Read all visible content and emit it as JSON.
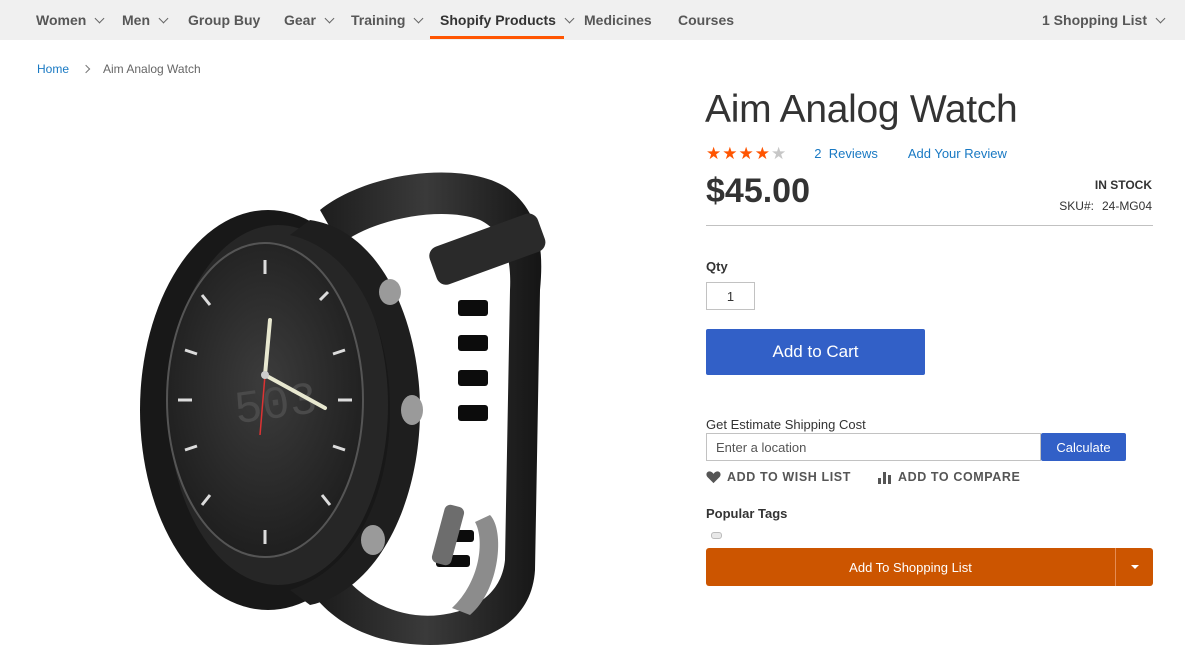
{
  "nav": {
    "items": [
      {
        "label": "Women",
        "has_menu": true
      },
      {
        "label": "Men",
        "has_menu": true
      },
      {
        "label": "Group Buy",
        "has_menu": false
      },
      {
        "label": "Gear",
        "has_menu": true
      },
      {
        "label": "Training",
        "has_menu": true
      },
      {
        "label": "Shopify Products",
        "has_menu": true,
        "active": true
      },
      {
        "label": "Medicines",
        "has_menu": false
      },
      {
        "label": "Courses",
        "has_menu": false
      }
    ],
    "shopping_list": "1 Shopping List",
    "active_color": "#ff5501"
  },
  "breadcrumb": {
    "home": "Home",
    "current": "Aim Analog Watch"
  },
  "product": {
    "title": "Aim Analog Watch",
    "rating": {
      "value": 4,
      "max": 5
    },
    "reviews_count": "2",
    "reviews_label": "Reviews",
    "add_review": "Add Your Review",
    "price": "$45.00",
    "stock": "In stock",
    "sku_label": "SKU#:",
    "sku": "24-MG04",
    "image_icon": "analog-watch-image"
  },
  "purchase": {
    "qty_label": "Qty",
    "qty_value": "1",
    "add_to_cart": "Add to Cart",
    "button_color": "#3260c7"
  },
  "shipping": {
    "label": "Get Estimate Shipping Cost",
    "placeholder": "Enter a location",
    "calculate": "Calculate"
  },
  "actions": {
    "wishlist": "Add to Wish List",
    "compare": "Add to Compare"
  },
  "tags": {
    "label": "Popular Tags"
  },
  "shopping_list_button": {
    "label": "Add To Shopping List",
    "color": "#cc5500"
  },
  "colors": {
    "star_on": "#ff5501",
    "link": "#1979c3"
  }
}
